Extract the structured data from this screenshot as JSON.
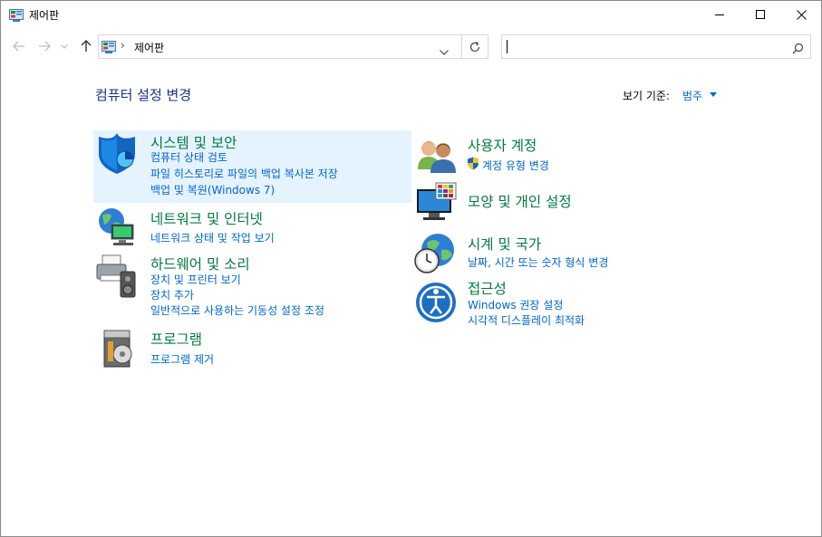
{
  "window": {
    "title": "제어판",
    "minimize": "minimize",
    "maximize": "maximize",
    "close": "close"
  },
  "nav": {
    "back": "back-arrow",
    "forward": "forward-arrow",
    "recent": "recent-dropdown",
    "up": "up-arrow"
  },
  "address": {
    "path": "제어판",
    "separator": "›"
  },
  "search": {
    "placeholder": ""
  },
  "main": {
    "title": "컴퓨터 설정 변경",
    "view_by_label": "보기 기준:",
    "view_by_value": "범주"
  },
  "categories": {
    "system": {
      "title": "시스템 및 보안",
      "links": [
        "컴퓨터 상태 검토",
        "파일 히스토리로 파일의 백업 복사본 저장",
        "백업 및 복원(Windows 7)"
      ]
    },
    "network": {
      "title": "네트워크 및 인터넷",
      "links": [
        "네트워크 상태 및 작업 보기"
      ]
    },
    "hardware": {
      "title": "하드웨어 및 소리",
      "links": [
        "장치 및 프린터 보기",
        "장치 추가",
        "일반적으로 사용하는 기동성 설정 조정"
      ]
    },
    "programs": {
      "title": "프로그램",
      "links": [
        "프로그램 제거"
      ]
    },
    "users": {
      "title": "사용자 계정",
      "links": [
        "계정 유형 변경"
      ]
    },
    "appearance": {
      "title": "모양 및 개인 설정",
      "links": []
    },
    "clock": {
      "title": "시계 및 국가",
      "links": [
        "날짜, 시간 또는 숫자 형식 변경"
      ]
    },
    "access": {
      "title": "접근성",
      "links": [
        "Windows 권장 설정",
        "시각적 디스플레이 최적화"
      ]
    }
  },
  "colors": {
    "category_title": "#007a3e",
    "link": "#0066cc",
    "page_title": "#1e3287",
    "highlight": "#e5f3ff"
  }
}
